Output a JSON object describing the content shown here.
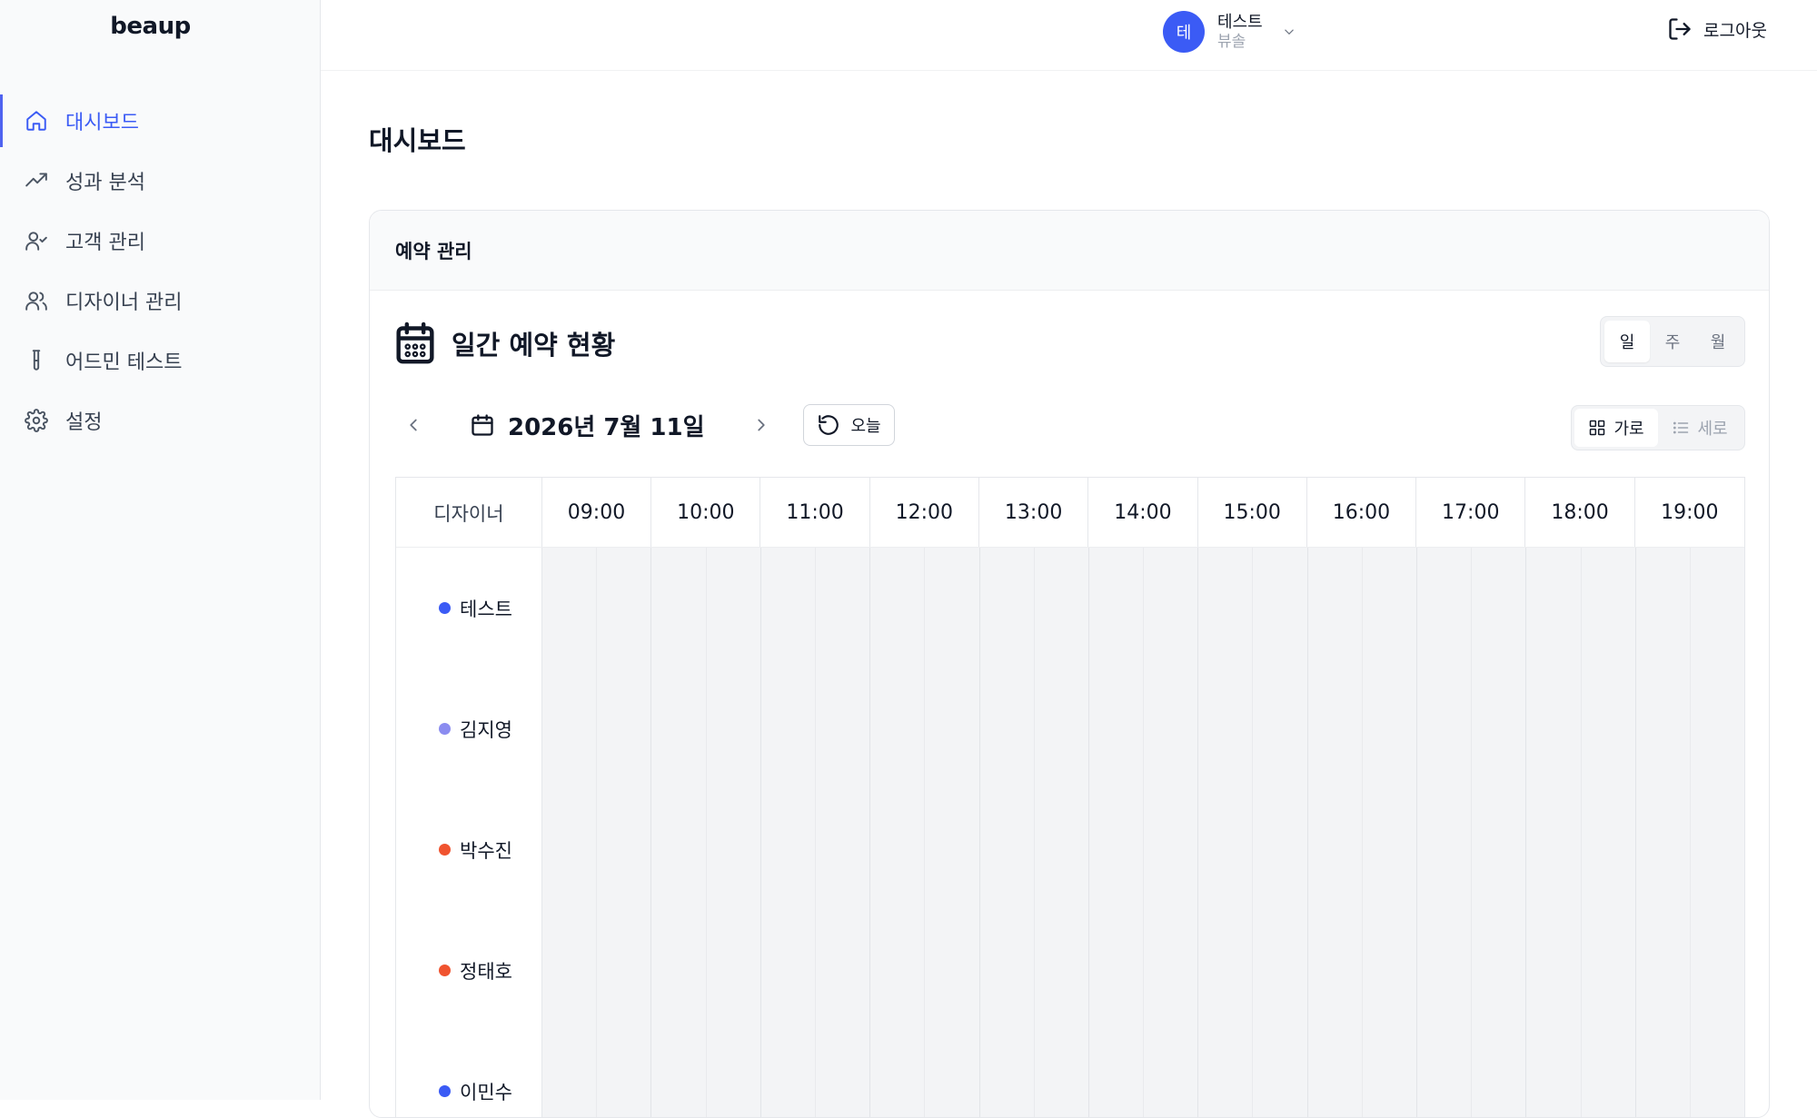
{
  "app": {
    "logo": "beaup"
  },
  "sidebar": {
    "items": [
      {
        "label": "대시보드",
        "icon": "home-icon",
        "active": true
      },
      {
        "label": "성과 분석",
        "icon": "trending-up-icon",
        "active": false
      },
      {
        "label": "고객 관리",
        "icon": "user-check-icon",
        "active": false
      },
      {
        "label": "디자이너 관리",
        "icon": "users-icon",
        "active": false
      },
      {
        "label": "어드민 테스트",
        "icon": "test-tube-icon",
        "active": false
      },
      {
        "label": "설정",
        "icon": "gear-icon",
        "active": false
      }
    ]
  },
  "topbar": {
    "avatar_initial": "테",
    "user_name": "테스트",
    "user_org": "뷰솔",
    "logout_label": "로그아웃"
  },
  "page": {
    "title": "대시보드"
  },
  "card": {
    "header": "예약 관리",
    "section_title": "일간 예약 현황",
    "period_tabs": [
      {
        "label": "일",
        "active": true
      },
      {
        "label": "주",
        "active": false
      },
      {
        "label": "월",
        "active": false
      }
    ],
    "date_label": "2026년 7월 11일",
    "today_label": "오늘",
    "layout_toggle": [
      {
        "label": "가로",
        "icon": "grid-icon",
        "active": true
      },
      {
        "label": "세로",
        "icon": "list-icon",
        "active": false
      }
    ],
    "schedule": {
      "designer_header": "디자이너",
      "hours": [
        "09:00",
        "10:00",
        "11:00",
        "12:00",
        "13:00",
        "14:00",
        "15:00",
        "16:00",
        "17:00",
        "18:00",
        "19:00"
      ],
      "designers": [
        {
          "name": "테스트",
          "color": "#3b5bf5"
        },
        {
          "name": "김지영",
          "color": "#8b8cf0"
        },
        {
          "name": "박수진",
          "color": "#f0532f"
        },
        {
          "name": "정태호",
          "color": "#f0532f"
        },
        {
          "name": "이민수",
          "color": "#3b5bf5"
        }
      ]
    }
  },
  "colors": {
    "accent": "#3b5bf5",
    "sidebar_bg": "#f9fafb",
    "slot_bg": "#f3f4f6"
  }
}
